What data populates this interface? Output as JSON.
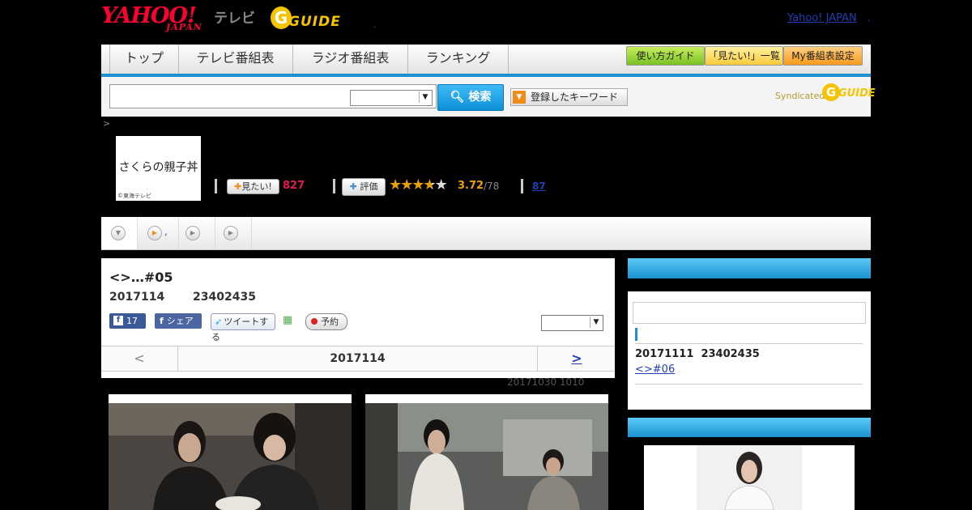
{
  "header": {
    "logo_yahoo": "YAHOO!",
    "logo_japan": "JAPAN",
    "logo_tv": "テレビ",
    "logo_g": "G",
    "logo_guide": "GUIDE",
    "logo_dot": ".",
    "yahoo_japan_link": "Yahoo! JAPAN",
    "trailing_dot": "."
  },
  "nav": {
    "tabs": [
      {
        "label": "トップ"
      },
      {
        "label": "テレビ番組表"
      },
      {
        "label": "ラジオ番組表"
      },
      {
        "label": "ランキング"
      }
    ],
    "guide_buttons": [
      {
        "label": "使い方ガイド"
      },
      {
        "label": "「見たい!」一覧"
      },
      {
        "label": "My番組表設定"
      }
    ],
    "accent_color": "#1a92d0"
  },
  "search": {
    "query": "",
    "select_value": "",
    "button_label": "検索",
    "keyword_button_label": "登録したキーワード",
    "syndicated_label": "Syndicated",
    "syndicated_g": "G",
    "syndicated_guide": "GUIDE"
  },
  "program": {
    "breadcrumb": ">",
    "thumb_title": "さくらの親子丼",
    "thumb_credit": "©東海テレビ",
    "mitai_label": "見たい!",
    "mitai_count": "827",
    "hyoka_label": "評価",
    "rating": 3.72,
    "rating_text": "3.72",
    "rating_count": "/78",
    "review_count": "87"
  },
  "subtabs": {
    "second_label": ","
  },
  "episode": {
    "title": "<>…#05",
    "date": "2017114",
    "time": "23402435",
    "fb_count": "17",
    "share_label": "シェア",
    "tweet_label": "ツイートする",
    "yoyaku_label": "予約",
    "select_value": "",
    "pager_prev": "<",
    "pager_date": "2017114",
    "pager_next": ">",
    "updated": "20171030  1010"
  },
  "sidebar": {
    "next_date": "20171111",
    "next_time": "23402435",
    "next_link": "<>#06"
  }
}
